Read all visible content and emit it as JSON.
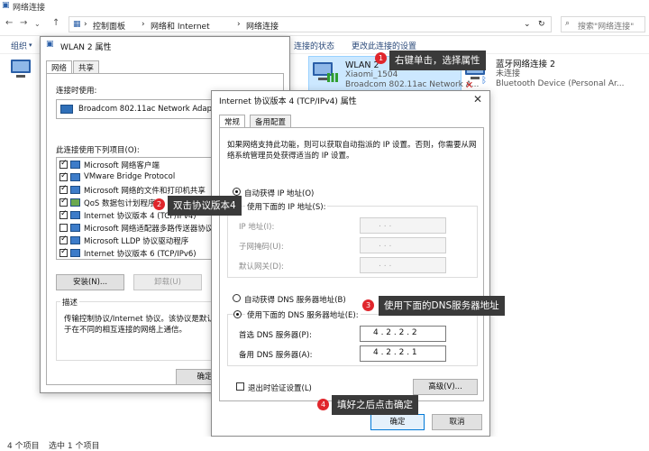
{
  "explorer": {
    "title": "网络连接",
    "breadcrumbs": [
      "控制面板",
      "网络和 Internet",
      "网络连接"
    ],
    "search_placeholder": "搜索\"网络连接\"",
    "commands": [
      "组织",
      "连接的状态",
      "更改此连接的设置"
    ],
    "status_left": "4 个项目",
    "status_right": "选中 1 个项目"
  },
  "adapters": [
    {
      "name": "WLAN 2",
      "line2": "Xiaomi_1504",
      "line3": "Broadcom 802.11ac Network A..."
    },
    {
      "name": "蓝牙网络连接 2",
      "line2": "未连接",
      "line3": "Bluetooth Device (Personal Ar..."
    }
  ],
  "wlan_dialog": {
    "title": "WLAN 2 属性",
    "tabs": [
      "网络",
      "共享"
    ],
    "connect_using_label": "连接时使用:",
    "adapter_name": "Broadcom 802.11ac Network Adapter",
    "items_label": "此连接使用下列项目(O):",
    "items": [
      {
        "label": "Microsoft 网络客户端",
        "checked": true
      },
      {
        "label": "VMware Bridge Protocol",
        "checked": true
      },
      {
        "label": "Microsoft 网络的文件和打印机共享",
        "checked": true
      },
      {
        "label": "QoS 数据包计划程序",
        "checked": true
      },
      {
        "label": "Internet 协议版本 4 (TCP/IPv4)",
        "checked": true
      },
      {
        "label": "Microsoft 网络适配器多路传送器协议",
        "checked": false
      },
      {
        "label": "Microsoft LLDP 协议驱动程序",
        "checked": true
      },
      {
        "label": "Internet 协议版本 6 (TCP/IPv6)",
        "checked": true
      }
    ],
    "install_label": "安装(N)...",
    "uninstall_label": "卸载(U)",
    "description_label": "描述",
    "description_text_1": "传输控制协议/Internet 协议。该协议是默认的广",
    "description_text_2": "于在不同的相互连接的网络上通信。",
    "ok_label": "确定"
  },
  "ipv4_dialog": {
    "title": "Internet 协议版本 4 (TCP/IPv4) 属性",
    "tabs": [
      "常规",
      "备用配置"
    ],
    "intro_1": "如果网络支持此功能，则可以获取自动指派的 IP 设置。否则，你需要从网",
    "intro_2": "络系统管理员处获得适当的 IP 设置。",
    "auto_ip_label": "自动获得 IP 地址(O)",
    "manual_ip_label": "使用下面的 IP 地址(S):",
    "ip_label": "IP 地址(I):",
    "mask_label": "子网掩码(U):",
    "gateway_label": "默认网关(D):",
    "empty_ip": ".    .    .",
    "auto_dns_label": "自动获得 DNS 服务器地址(B)",
    "manual_dns_label": "使用下面的 DNS 服务器地址(E):",
    "preferred_dns_label": "首选 DNS 服务器(P):",
    "alternate_dns_label": "备用 DNS 服务器(A):",
    "preferred_dns": "4  .  2  .  2  .  2",
    "alternate_dns": "4  .  2  .  2  .  1",
    "validate_label": "退出时验证设置(L)",
    "advanced_label": "高级(V)...",
    "ok_label": "确定",
    "cancel_label": "取消"
  },
  "callouts": [
    {
      "num": "1",
      "text": "右键单击，选择属性"
    },
    {
      "num": "2",
      "text": "双击协议版本4"
    },
    {
      "num": "3",
      "text": "使用下面的DNS服务器地址"
    },
    {
      "num": "4",
      "text": "填好之后点击确定"
    }
  ],
  "colors": {
    "callout_bg": "#3a3a3a",
    "badge": "#e0262c",
    "accent": "#0078d7"
  }
}
